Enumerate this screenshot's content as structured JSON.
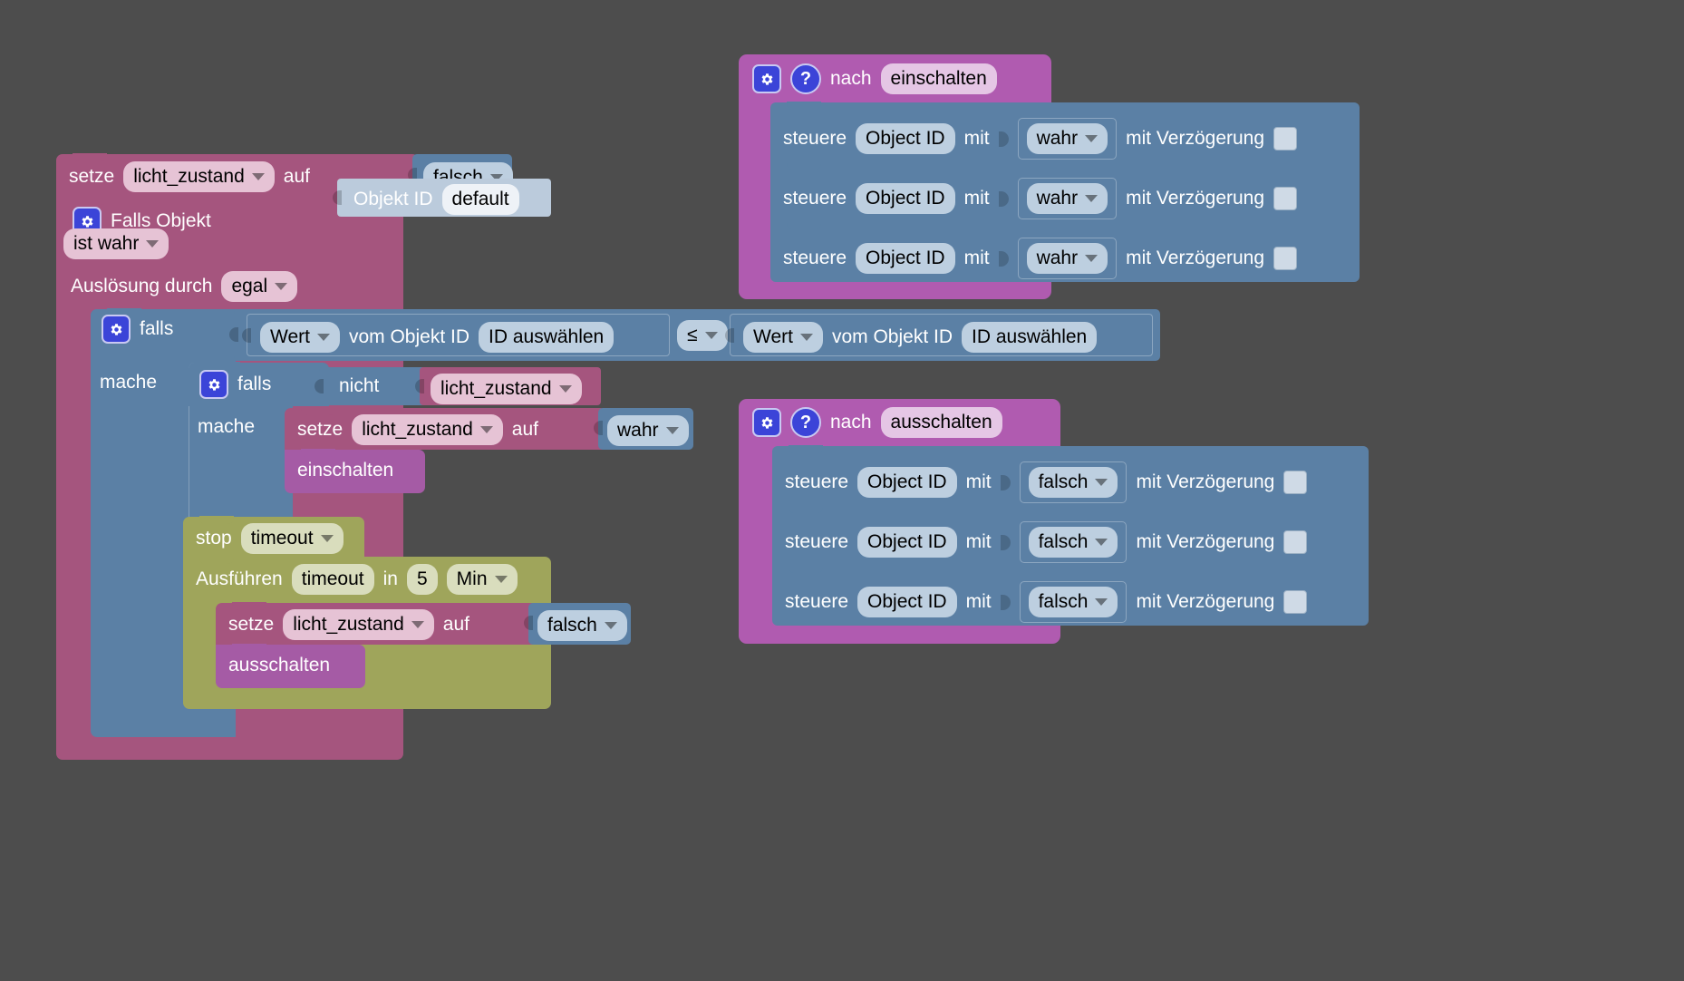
{
  "editor": {
    "background_color": "#4d4d4d",
    "app": "Blockly Script Editor"
  },
  "colors": {
    "variables": "#a5557e",
    "logic": "#5b80a5",
    "timer": "#9fa55b",
    "function": "#a55ba5",
    "sendto": "#b05bb0",
    "object_id": "#bbcbdc",
    "icon_blue": "#3b44d8"
  },
  "script_left": {
    "set_var": {
      "keyword": "setze",
      "variable": "licht_zustand",
      "middle": "auf",
      "value": "falsch"
    },
    "trigger": {
      "gear_icon": "gear-icon",
      "title": "Falls Objekt",
      "object_id_label": "Objekt ID",
      "object_id_value": "default",
      "condition": "ist wahr",
      "trigger_label": "Auslösung durch",
      "trigger_value": "egal"
    },
    "if_outer": {
      "gear_icon": "gear-icon",
      "keyword": "falls",
      "do_label": "mache",
      "compare": {
        "left": {
          "attr": "Wert",
          "label": "vom Objekt ID",
          "id": "ID auswählen"
        },
        "operator": "≤",
        "right": {
          "attr": "Wert",
          "label": "vom Objekt ID",
          "id": "ID auswählen"
        }
      }
    },
    "if_inner": {
      "gear_icon": "gear-icon",
      "keyword": "falls",
      "not_label": "nicht",
      "not_value": "licht_zustand",
      "do_label": "mache",
      "set_var": {
        "keyword": "setze",
        "variable": "licht_zustand",
        "middle": "auf",
        "value": "wahr"
      },
      "call": "einschalten"
    },
    "stop_timeout": {
      "keyword": "stop",
      "name": "timeout"
    },
    "run_timeout": {
      "keyword": "Ausführen",
      "name": "timeout",
      "in_label": "in",
      "delay": "5",
      "unit": "Min",
      "set_var": {
        "keyword": "setze",
        "variable": "licht_zustand",
        "middle": "auf",
        "value": "falsch"
      },
      "call": "ausschalten"
    }
  },
  "script_on": {
    "header": {
      "gear_icon": "gear-icon",
      "help_icon": "help-icon",
      "keyword": "nach",
      "name": "einschalten"
    },
    "rows": [
      {
        "keyword": "steuere",
        "object_id": "Object ID",
        "mit": "mit",
        "value": "wahr",
        "delay_label": "mit Verzögerung",
        "checkbox": false
      },
      {
        "keyword": "steuere",
        "object_id": "Object ID",
        "mit": "mit",
        "value": "wahr",
        "delay_label": "mit Verzögerung",
        "checkbox": false
      },
      {
        "keyword": "steuere",
        "object_id": "Object ID",
        "mit": "mit",
        "value": "wahr",
        "delay_label": "mit Verzögerung",
        "checkbox": false
      }
    ]
  },
  "script_off": {
    "header": {
      "gear_icon": "gear-icon",
      "help_icon": "help-icon",
      "keyword": "nach",
      "name": "ausschalten"
    },
    "rows": [
      {
        "keyword": "steuere",
        "object_id": "Object ID",
        "mit": "mit",
        "value": "falsch",
        "delay_label": "mit Verzögerung",
        "checkbox": false
      },
      {
        "keyword": "steuere",
        "object_id": "Object ID",
        "mit": "mit",
        "value": "falsch",
        "delay_label": "mit Verzögerung",
        "checkbox": false
      },
      {
        "keyword": "steuere",
        "object_id": "Object ID",
        "mit": "mit",
        "value": "falsch",
        "delay_label": "mit Verzögerung",
        "checkbox": false
      }
    ]
  }
}
